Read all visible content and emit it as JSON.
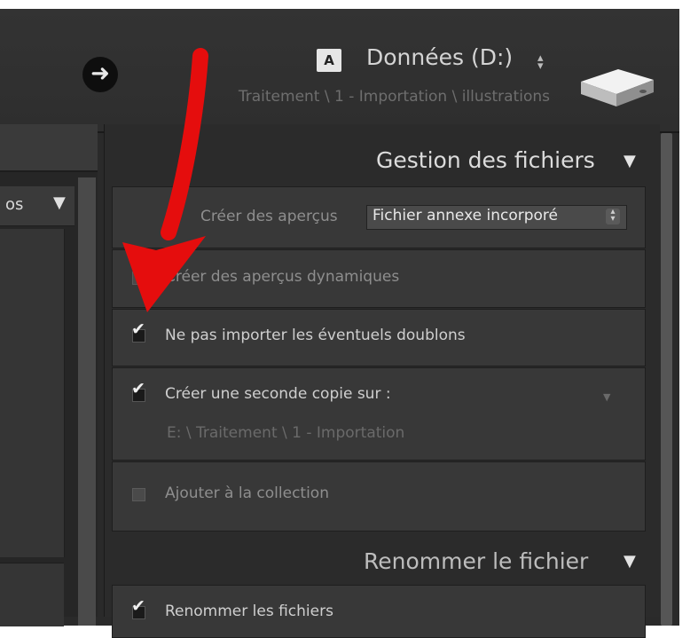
{
  "header": {
    "drive_letter": "A",
    "drive_name": "Données (D:)",
    "drive_stepper": "⌃⌄",
    "path": "Traitement \\ 1 - Importation \\ illustrations",
    "navigate_icon": "arrow-right-icon",
    "drive_icon": "hard-drive-icon"
  },
  "left_panel": {
    "sub_label": "os",
    "sub_arrow": "▼"
  },
  "file_management": {
    "title": "Gestion des fichiers",
    "toggle": "▼",
    "previews_label": "Créer des aperçus",
    "previews_value": "Fichier annexe incorporé",
    "smart_previews_label": "Créer des aperçus dynamiques",
    "smart_previews_checked": false,
    "no_duplicates_label": "Ne pas importer les éventuels doublons",
    "no_duplicates_checked": true,
    "second_copy_label": "Créer une seconde copie sur :",
    "second_copy_checked": true,
    "second_copy_path": "E: \\ Traitement \\ 1 - Importation",
    "add_collection_label": "Ajouter à la collection",
    "add_collection_checked": false
  },
  "rename": {
    "title": "Renommer le fichier",
    "toggle": "▼",
    "rename_files_label": "Renommer les fichiers",
    "rename_files_checked": true
  },
  "colors": {
    "accent_arrow": "#e50d0d"
  }
}
